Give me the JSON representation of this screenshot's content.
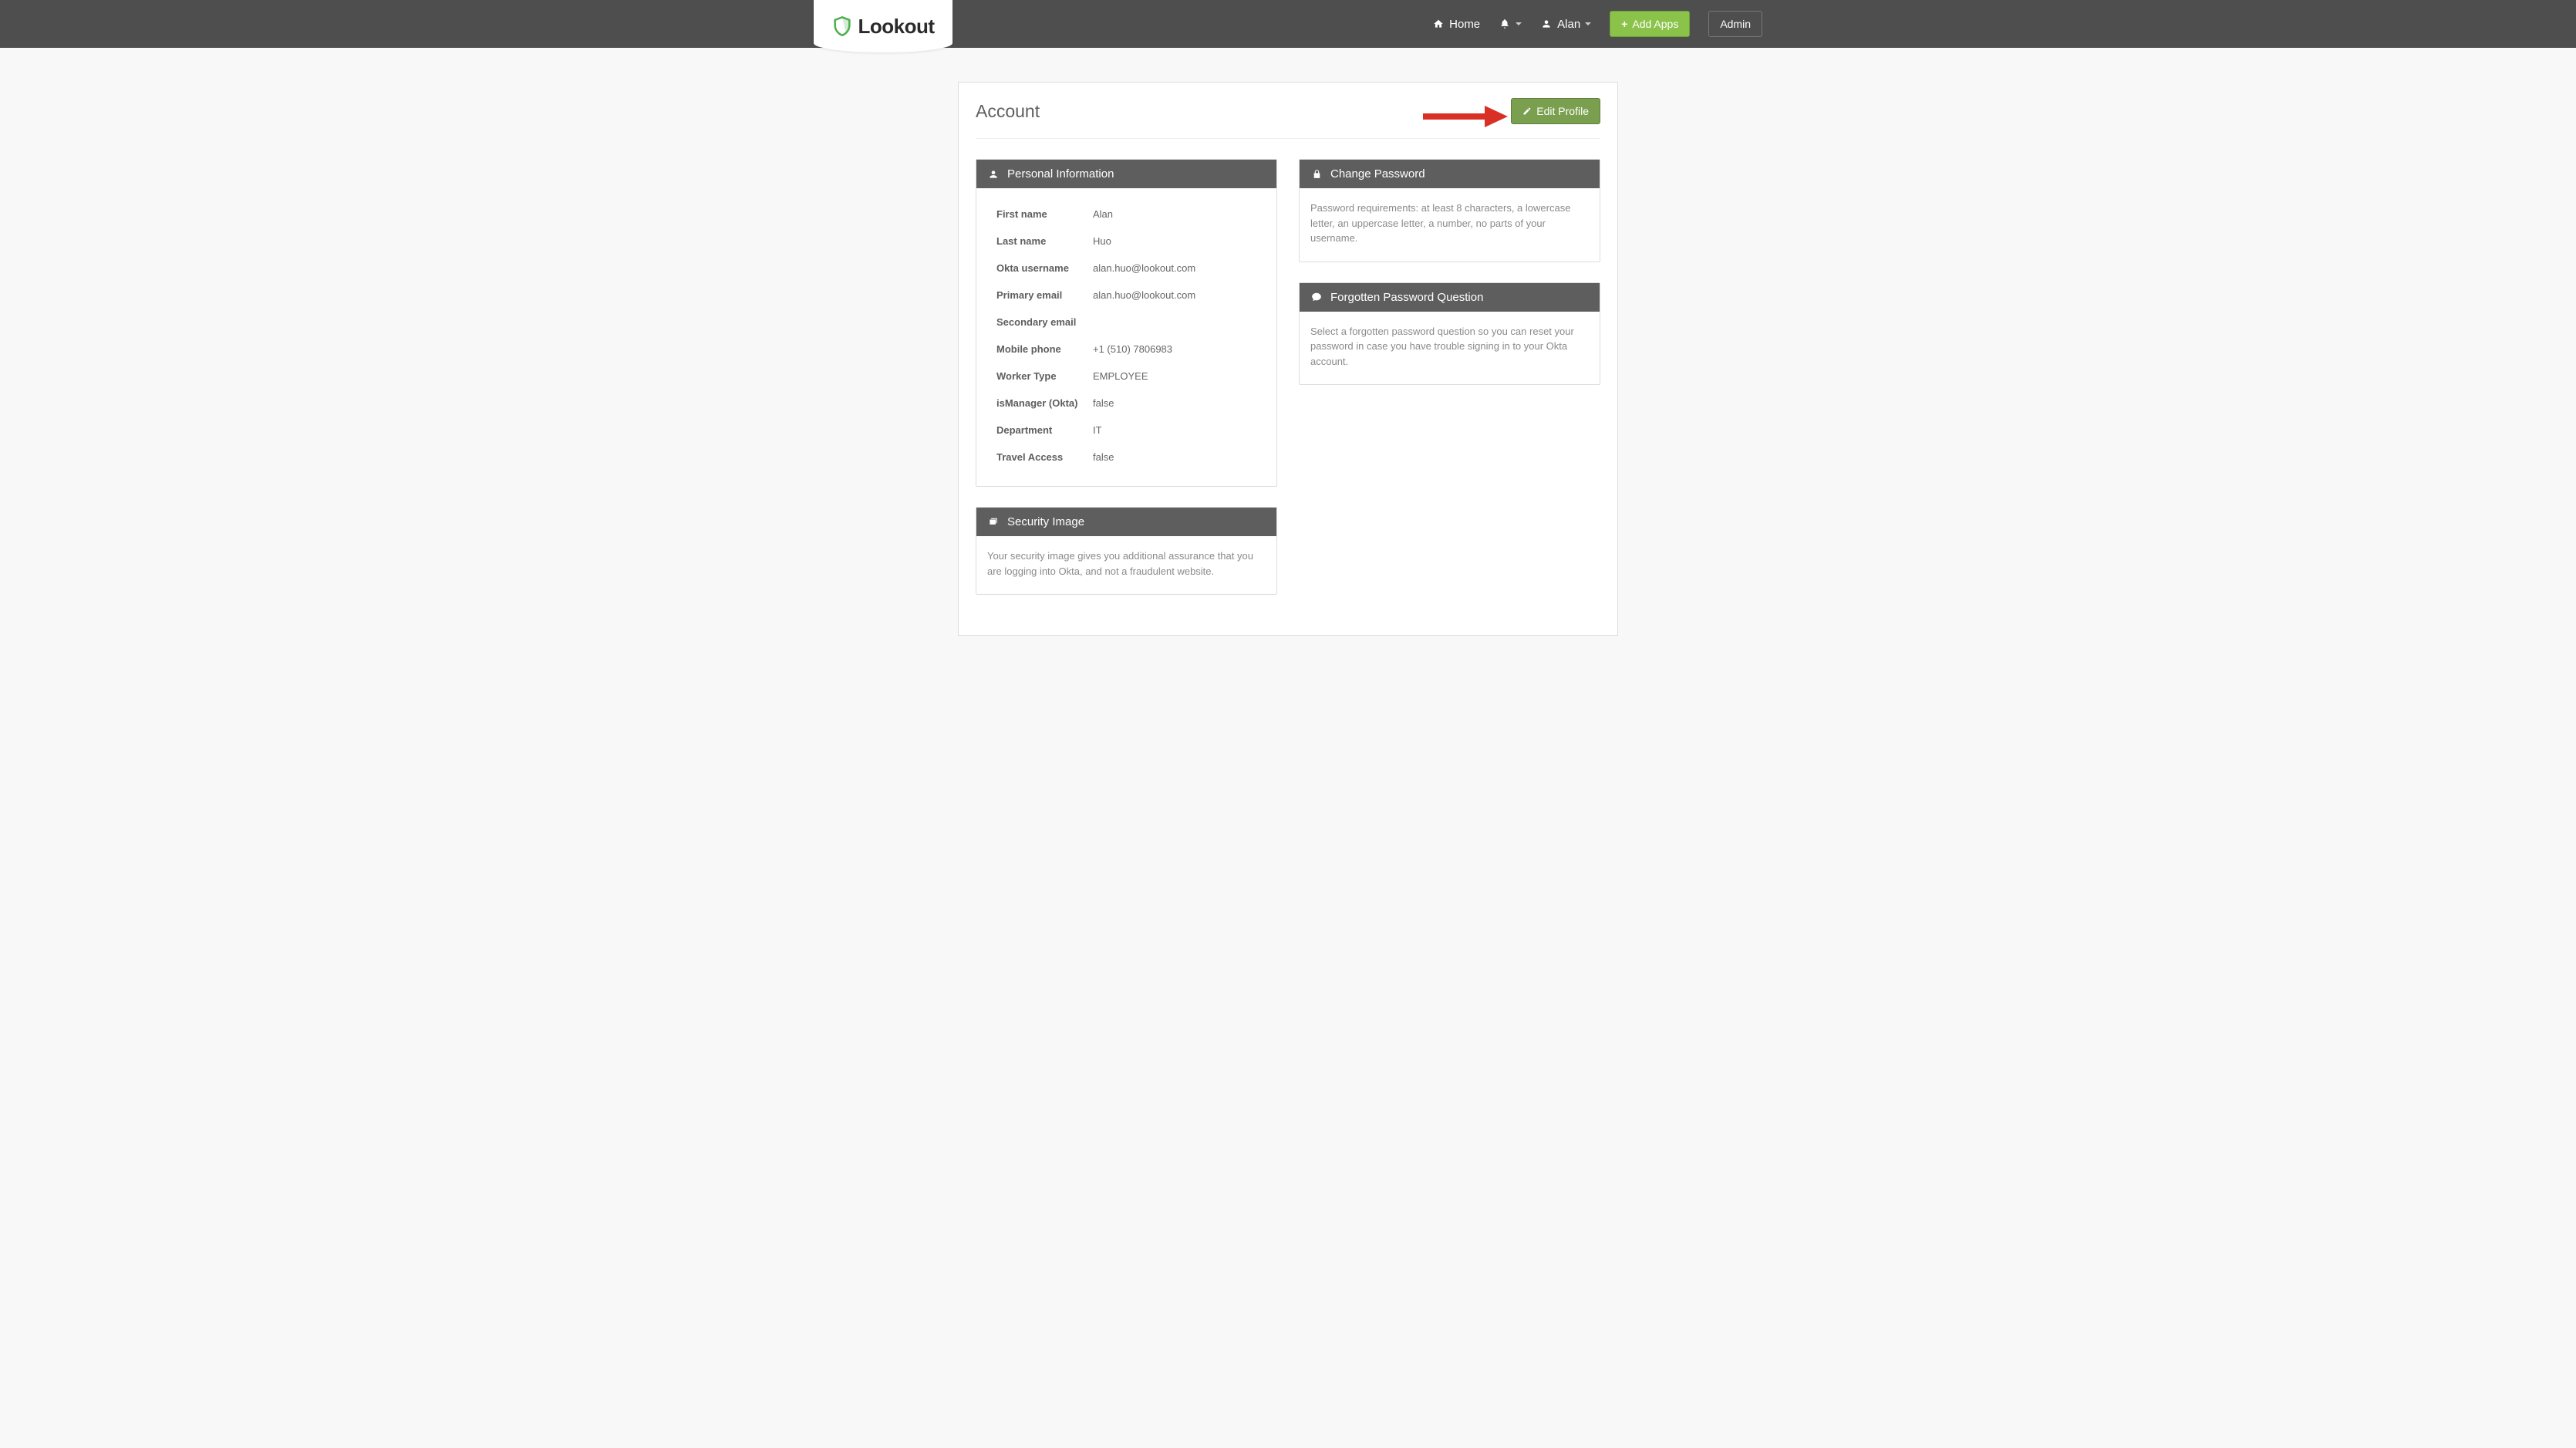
{
  "brand": {
    "name": "Lookout"
  },
  "nav": {
    "home": "Home",
    "user": "Alan",
    "add_apps": "Add Apps",
    "admin": "Admin"
  },
  "page": {
    "title": "Account",
    "edit_profile": "Edit Profile"
  },
  "personal": {
    "title": "Personal Information",
    "fields": {
      "first_name": {
        "label": "First name",
        "value": "Alan"
      },
      "last_name": {
        "label": "Last name",
        "value": "Huo"
      },
      "okta_username": {
        "label": "Okta username",
        "value": "alan.huo@lookout.com"
      },
      "primary_email": {
        "label": "Primary email",
        "value": "alan.huo@lookout.com"
      },
      "secondary_email": {
        "label": "Secondary email",
        "value": ""
      },
      "mobile_phone": {
        "label": "Mobile phone",
        "value": "+1 (510) 7806983"
      },
      "worker_type": {
        "label": "Worker Type",
        "value": "EMPLOYEE"
      },
      "is_manager": {
        "label": "isManager (Okta)",
        "value": "false"
      },
      "department": {
        "label": "Department",
        "value": "IT"
      },
      "travel_access": {
        "label": "Travel Access",
        "value": "false"
      }
    }
  },
  "change_password": {
    "title": "Change Password",
    "desc": "Password requirements: at least 8 characters, a lowercase letter, an uppercase letter, a number, no parts of your username."
  },
  "forgotten": {
    "title": "Forgotten Password Question",
    "desc": "Select a forgotten password question so you can reset your password in case you have trouble signing in to your Okta account."
  },
  "security_image": {
    "title": "Security Image",
    "desc": "Your security image gives you additional assurance that you are logging into Okta, and not a fraudulent website."
  }
}
